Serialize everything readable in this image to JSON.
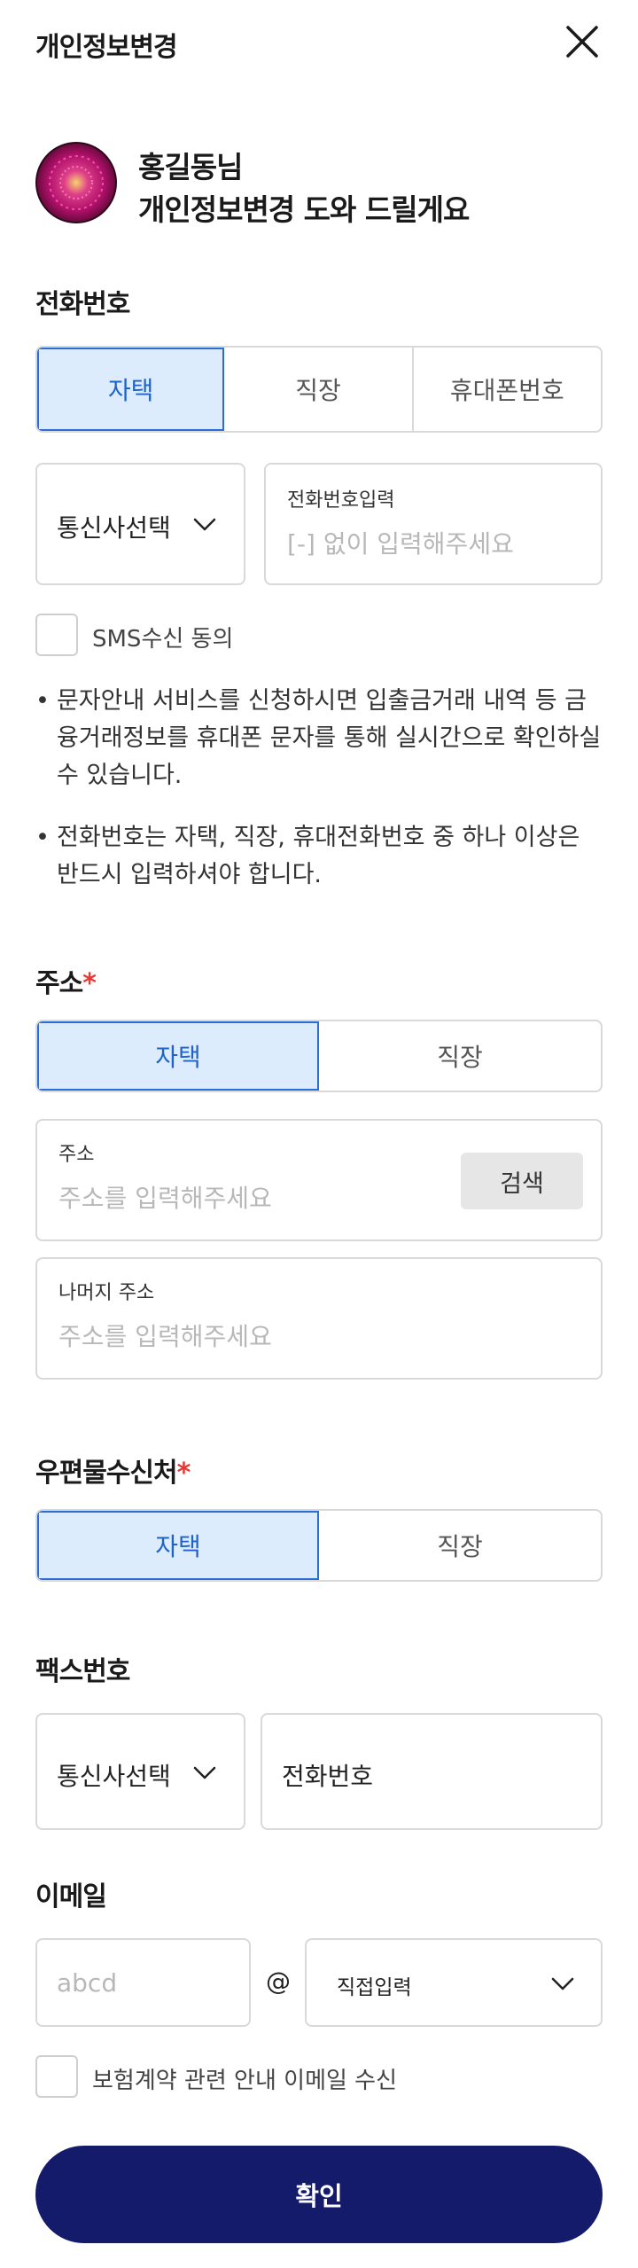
{
  "header": {
    "title": "개인정보변경"
  },
  "profile": {
    "greeting": "홍길동님",
    "subtitle": "개인정보변경 도와 드릴게요"
  },
  "phone": {
    "title": "전화번호",
    "tabs": [
      "자택",
      "직장",
      "휴대폰번호"
    ],
    "carrier_select": "통신사선택",
    "number_label": "전화번호입력",
    "number_placeholder": "[-] 없이 입력해주세요",
    "sms_consent": "SMS수신 동의",
    "notes": [
      "문자안내 서비스를 신청하시면 입출금거래 내역 등 금융거래정보를 휴대폰 문자를 통해 실시간으로 확인하실 수 있습니다.",
      "전화번호는 자택, 직장, 휴대전화번호 중 하나 이상은 반드시 입력하셔야 합니다."
    ]
  },
  "address": {
    "title": "주소",
    "required_mark": "*",
    "tabs": [
      "자택",
      "직장"
    ],
    "addr_label": "주소",
    "addr_placeholder": "주소를 입력해주세요",
    "search_button": "검색",
    "detail_label": "나머지 주소",
    "detail_placeholder": "주소를 입력해주세요"
  },
  "mail": {
    "title": "우편물수신처",
    "required_mark": "*",
    "tabs": [
      "자택",
      "직장"
    ]
  },
  "fax": {
    "title": "팩스번호",
    "carrier_select": "통신사선택",
    "number_field": "전화번호"
  },
  "email": {
    "title": "이메일",
    "local_placeholder": "abcd",
    "at_sign": "@",
    "domain_select": "직접입력",
    "consent": "보험계약 관련 안내 이메일 수신"
  },
  "confirm_button": "확인",
  "colors": {
    "accent": "#2a6fd6",
    "active_bg": "#dcecfd",
    "primary_button": "#141b6b",
    "required": "#e53935"
  }
}
